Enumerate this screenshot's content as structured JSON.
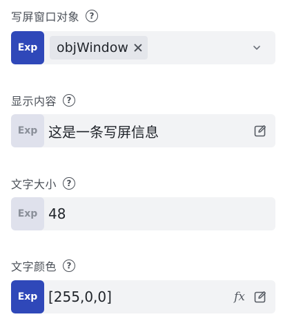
{
  "fields": [
    {
      "label": "写屏窗口对象",
      "help": "?",
      "exp": "Exp",
      "tag": "objWindow"
    },
    {
      "label": "显示内容",
      "help": "?",
      "exp": "Exp",
      "value": "这是一条写屏信息"
    },
    {
      "label": "文字大小",
      "help": "?",
      "exp": "Exp",
      "value": "48"
    },
    {
      "label": "文字颜色",
      "help": "?",
      "exp": "Exp",
      "value": "[255,0,0]",
      "fx": "fx"
    }
  ],
  "icons": {
    "help": "question-circle-icon",
    "tag_close": "close-icon",
    "dropdown": "chevron-down-icon",
    "edit": "edit-icon",
    "formula": "fx-icon"
  },
  "colors": {
    "exp_active": "#2f48b9",
    "exp_inactive": "#dfe1ec",
    "field_bg": "#f2f3f5"
  }
}
